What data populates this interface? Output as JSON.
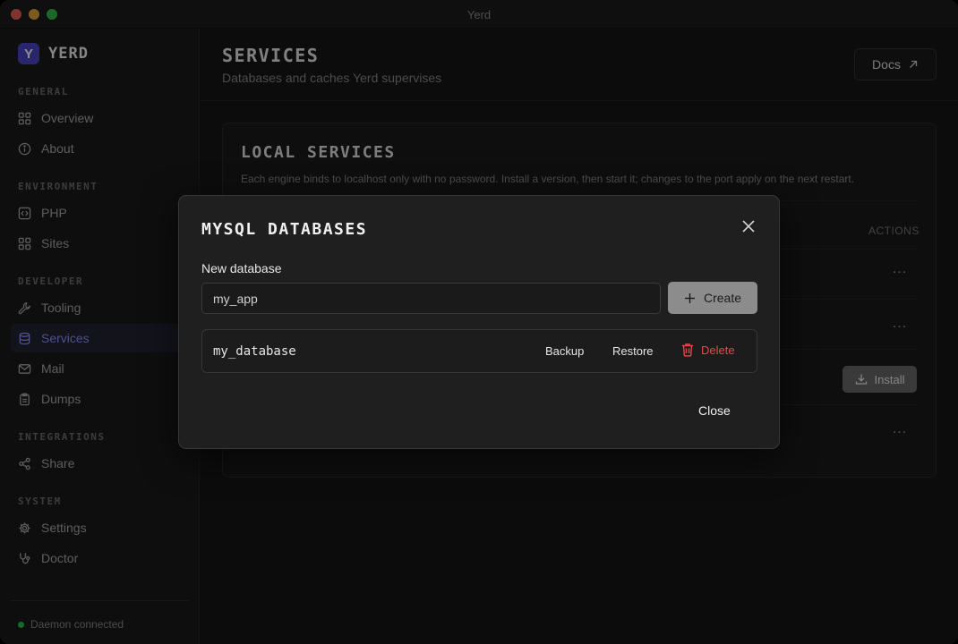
{
  "window": {
    "title": "Yerd"
  },
  "brand": {
    "logo_letter": "Y",
    "name": "YERD"
  },
  "sidebar": {
    "sections": [
      {
        "label": "GENERAL"
      },
      {
        "label": "ENVIRONMENT"
      },
      {
        "label": "DEVELOPER"
      },
      {
        "label": "INTEGRATIONS"
      },
      {
        "label": "SYSTEM"
      }
    ],
    "items": [
      {
        "label": "Overview",
        "icon": "grid-icon"
      },
      {
        "label": "About",
        "icon": "info-icon"
      },
      {
        "label": "PHP",
        "icon": "code-icon"
      },
      {
        "label": "Sites",
        "icon": "grid-icon"
      },
      {
        "label": "Tooling",
        "icon": "wrench-icon"
      },
      {
        "label": "Services",
        "icon": "database-icon",
        "active": true
      },
      {
        "label": "Mail",
        "icon": "mail-icon"
      },
      {
        "label": "Dumps",
        "icon": "clipboard-icon"
      },
      {
        "label": "Share",
        "icon": "share-icon"
      },
      {
        "label": "Settings",
        "icon": "gear-icon"
      },
      {
        "label": "Doctor",
        "icon": "stethoscope-icon"
      }
    ],
    "status": {
      "label": "Daemon connected",
      "color": "#2fbf4f"
    }
  },
  "header": {
    "title": "SERVICES",
    "subtitle": "Databases and caches Yerd supervises",
    "docs_label": "Docs"
  },
  "card": {
    "title": "LOCAL SERVICES",
    "description": "Each engine binds to localhost only with no password. Install a version, then start it; changes to the port apply on the next restart.",
    "actions_header": "ACTIONS",
    "more_label": "...",
    "install_label": "Install"
  },
  "modal": {
    "title": "MYSQL DATABASES",
    "new_label": "New database",
    "input_value": "my_app",
    "create_label": "Create",
    "databases": [
      {
        "name": "my_database",
        "backup_label": "Backup",
        "restore_label": "Restore",
        "delete_label": "Delete"
      }
    ],
    "close_label": "Close"
  },
  "colors": {
    "accent": "#8f93ff",
    "brand": "#4b46c7",
    "danger": "#e24a4a"
  }
}
